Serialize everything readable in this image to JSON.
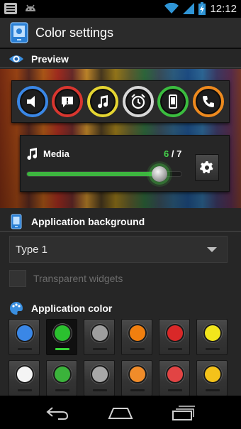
{
  "status_bar": {
    "time": "12:12",
    "icons": [
      "notification-list-icon",
      "android-icon",
      "wifi-icon",
      "signal-icon",
      "battery-charging-icon"
    ]
  },
  "action_bar": {
    "title": "Color settings",
    "icon": "app-device-icon"
  },
  "preview_section": {
    "label": "Preview",
    "icon": "eye-icon"
  },
  "ring_icons": [
    {
      "name": "speaker",
      "icon": "speaker-icon",
      "color": "#3a87e6"
    },
    {
      "name": "alert",
      "icon": "alert-icon",
      "color": "#d9362f"
    },
    {
      "name": "music",
      "icon": "music-note-icon",
      "color": "#e5d532"
    },
    {
      "name": "alarm",
      "icon": "alarm-clock-icon",
      "color": "#d8d8d8"
    },
    {
      "name": "phone",
      "icon": "phone-device-icon",
      "color": "#3bbd3f"
    },
    {
      "name": "call",
      "icon": "call-icon",
      "color": "#ee8a1e"
    }
  ],
  "media": {
    "label": "Media",
    "current": "6",
    "separator": " / ",
    "max": "7",
    "level": 0.86,
    "accent": "#3db53f",
    "settings_icon": "gear-icon"
  },
  "application_background": {
    "label": "Application background",
    "icon": "phone-background-icon",
    "dropdown_value": "Type 1",
    "transparent_widgets_label": "Transparent widgets",
    "transparent_widgets_checked": false
  },
  "application_color": {
    "label": "Application color",
    "icon": "palette-icon",
    "selected_index": 1,
    "swatches": [
      "#3a87e6",
      "#2bc02f",
      "#9e9e9e",
      "#f07f0f",
      "#d92828",
      "#f2e51c",
      "#f4f4f4",
      "#3bb33b",
      "#a8a8a8",
      "#f08c2a",
      "#e24444",
      "#f4c21a"
    ]
  },
  "nav_bar": {
    "buttons": [
      "back-icon",
      "home-icon",
      "recent-apps-icon"
    ]
  }
}
